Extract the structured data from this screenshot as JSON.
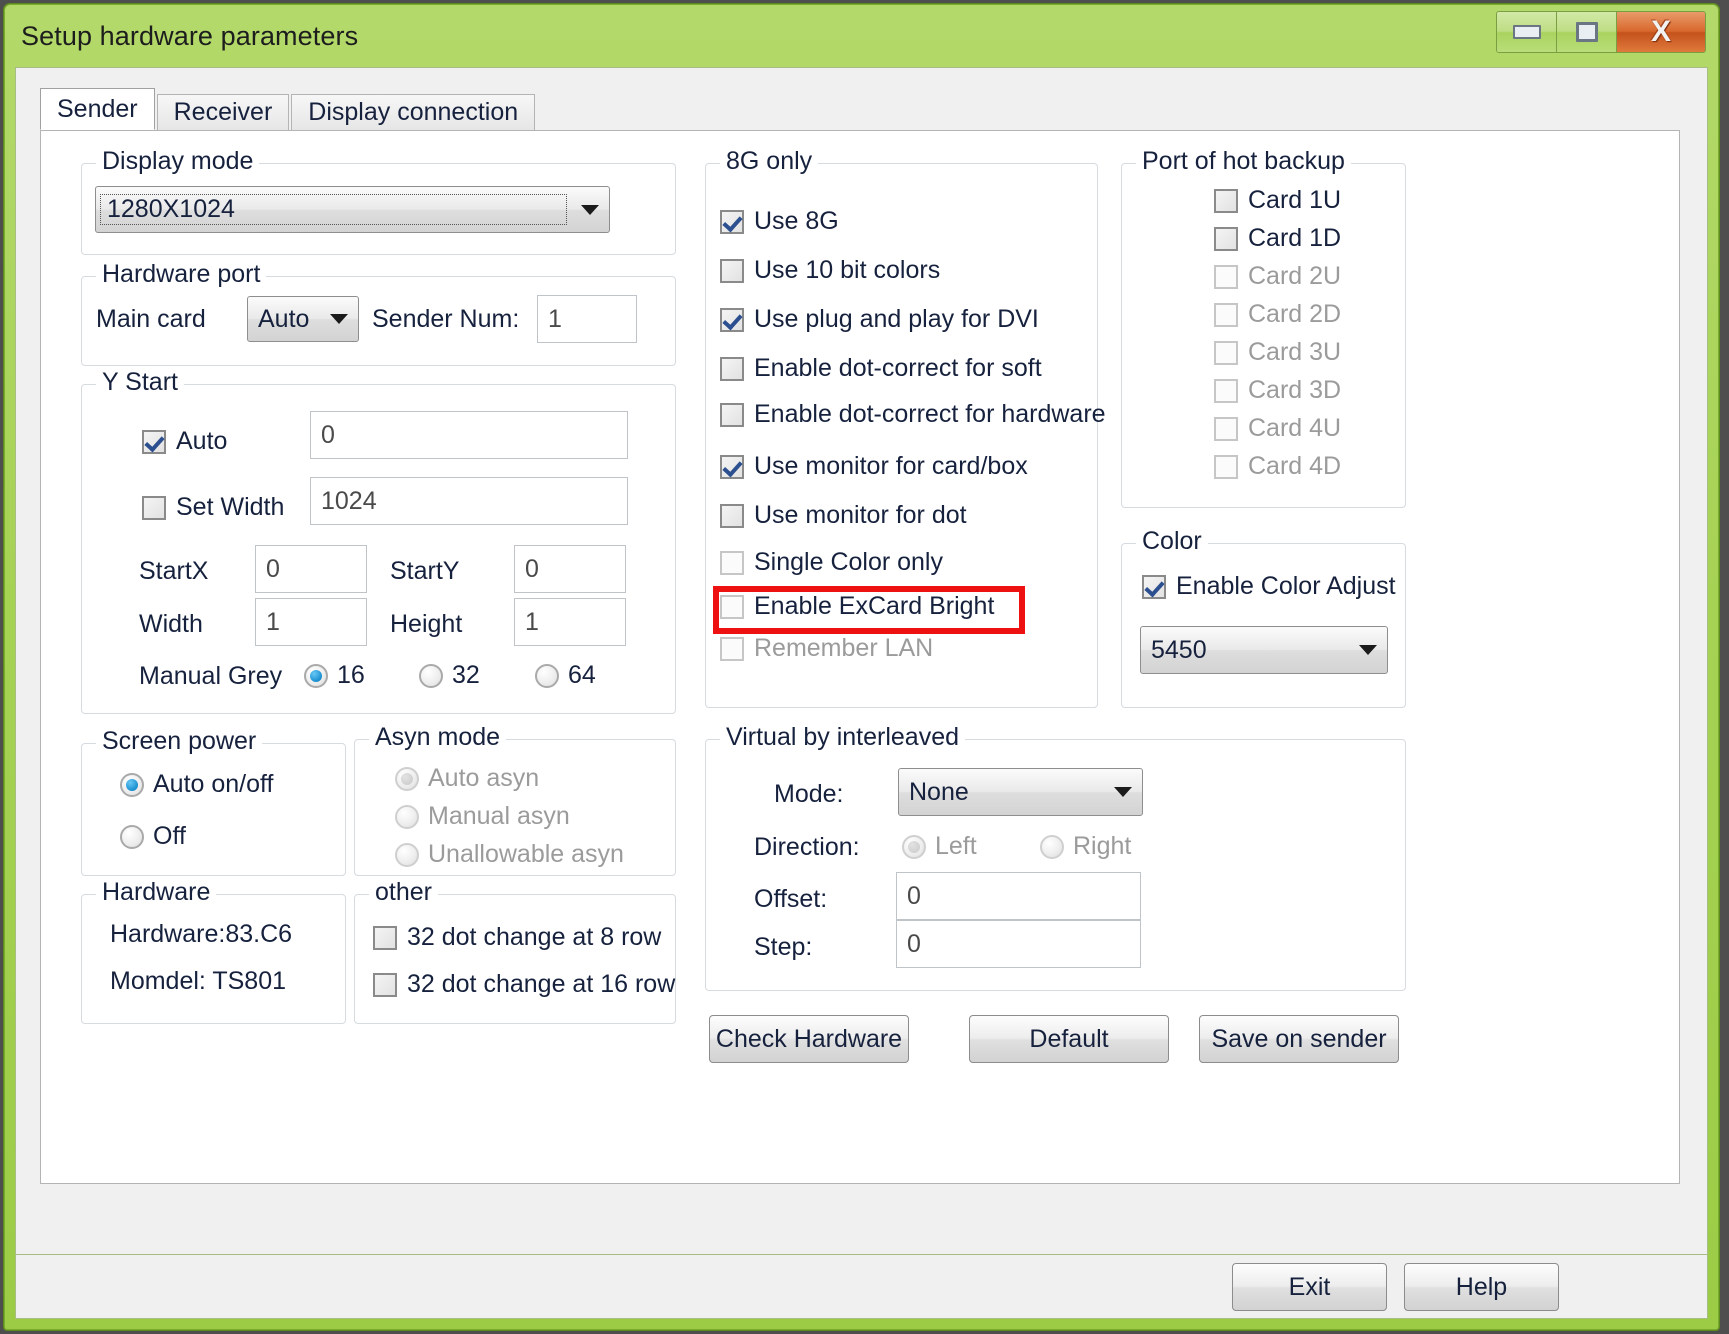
{
  "window": {
    "title": "Setup hardware parameters",
    "minimize_label": "minimize",
    "maximize_label": "maximize",
    "close_label": "X"
  },
  "tabs": [
    {
      "label": "Sender",
      "active": true
    },
    {
      "label": "Receiver",
      "active": false
    },
    {
      "label": "Display connection",
      "active": false
    }
  ],
  "display_mode": {
    "group_label": "Display mode",
    "value": "1280X1024"
  },
  "hardware_port": {
    "group_label": "Hardware port",
    "main_card_label": "Main card",
    "main_card_value": "Auto",
    "sender_num_label": "Sender Num:",
    "sender_num_value": "1"
  },
  "y_start": {
    "group_label": "Y Start",
    "auto_label": "Auto",
    "auto_checked": true,
    "auto_value": "0",
    "set_width_label": "Set Width",
    "set_width_checked": false,
    "set_width_value": "1024",
    "startx_label": "StartX",
    "startx_value": "0",
    "starty_label": "StartY",
    "starty_value": "0",
    "width_label": "Width",
    "width_value": "1",
    "height_label": "Height",
    "height_value": "1",
    "manual_grey_label": "Manual Grey",
    "grey_options": [
      {
        "label": "16",
        "selected": true
      },
      {
        "label": "32",
        "selected": false
      },
      {
        "label": "64",
        "selected": false
      }
    ]
  },
  "screen_power": {
    "group_label": "Screen power",
    "options": [
      {
        "label": "Auto on/off",
        "selected": true
      },
      {
        "label": "Off",
        "selected": false
      }
    ]
  },
  "asyn_mode": {
    "group_label": "Asyn mode",
    "disabled": true,
    "options": [
      {
        "label": "Auto asyn",
        "selected": true
      },
      {
        "label": "Manual asyn",
        "selected": false
      },
      {
        "label": "Unallowable asyn",
        "selected": false
      }
    ]
  },
  "hardware": {
    "group_label": "Hardware",
    "line1": "Hardware:83.C6",
    "line2": "Momdel: TS801"
  },
  "other": {
    "group_label": "other",
    "items": [
      {
        "label": "32 dot change at 8 row",
        "checked": false
      },
      {
        "label": "32 dot change at 16 row",
        "checked": false
      }
    ]
  },
  "eight_g_only": {
    "group_label": "8G only",
    "items": [
      {
        "label": "Use 8G",
        "checked": true,
        "disabled": false
      },
      {
        "label": "Use 10 bit colors",
        "checked": false,
        "disabled": false
      },
      {
        "label": "Use plug and play for DVI",
        "checked": true,
        "disabled": false
      },
      {
        "label": "Enable dot-correct for soft",
        "checked": false,
        "disabled": false
      },
      {
        "label": "Enable dot-correct for hardware",
        "checked": false,
        "disabled": false
      },
      {
        "label": "Use monitor for card/box",
        "checked": true,
        "disabled": false
      },
      {
        "label": "Use monitor for dot",
        "checked": false,
        "disabled": false
      },
      {
        "label": "Single Color only",
        "checked": false,
        "disabled": false
      },
      {
        "label": "Enable ExCard Bright",
        "checked": false,
        "disabled": false
      },
      {
        "label": "Remember LAN",
        "checked": false,
        "disabled": true
      }
    ],
    "highlight_label": "Enable ExCard Bright",
    "highlight_color": "#ee1111"
  },
  "port_hot_backup": {
    "group_label": "Port of hot backup",
    "items": [
      {
        "label": "Card 1U",
        "checked": false,
        "disabled": false
      },
      {
        "label": "Card 1D",
        "checked": false,
        "disabled": false
      },
      {
        "label": "Card 2U",
        "checked": false,
        "disabled": true
      },
      {
        "label": "Card 2D",
        "checked": false,
        "disabled": true
      },
      {
        "label": "Card 3U",
        "checked": false,
        "disabled": true
      },
      {
        "label": "Card 3D",
        "checked": false,
        "disabled": true
      },
      {
        "label": "Card 4U",
        "checked": false,
        "disabled": true
      },
      {
        "label": "Card 4D",
        "checked": false,
        "disabled": true
      }
    ]
  },
  "color": {
    "group_label": "Color",
    "enable_label": "Enable Color Adjust",
    "enable_checked": true,
    "value": "5450"
  },
  "virtual_interleaved": {
    "group_label": "Virtual by interleaved",
    "mode_label": "Mode:",
    "mode_value": "None",
    "direction_label": "Direction:",
    "direction_options": [
      {
        "label": "Left",
        "selected": true
      },
      {
        "label": "Right",
        "selected": false
      }
    ],
    "offset_label": "Offset:",
    "offset_value": "0",
    "step_label": "Step:",
    "step_value": "0"
  },
  "action_buttons": {
    "check_hardware": "Check Hardware",
    "default": "Default",
    "save_on_sender": "Save on sender"
  },
  "footer_buttons": {
    "exit": "Exit",
    "help": "Help"
  }
}
